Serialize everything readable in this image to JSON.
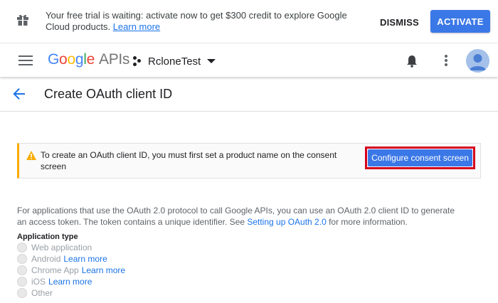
{
  "trial_banner": {
    "message": "Your free trial is waiting: activate now to get $300 credit to explore Google Cloud products.",
    "learn_more": "Learn more",
    "dismiss_label": "DISMISS",
    "activate_label": "ACTIVATE",
    "icon": "gift-icon"
  },
  "app_bar": {
    "logo": {
      "G": "G",
      "o1": "o",
      "o2": "o",
      "g": "g",
      "l": "l",
      "e": "e",
      "apis": "APIs"
    },
    "project_name": "RcloneTest",
    "icons": [
      "menu-icon",
      "project-icon",
      "caret-down-icon",
      "bell-icon",
      "more-vert-icon",
      "avatar"
    ]
  },
  "page": {
    "title": "Create OAuth client ID",
    "back_icon": "arrow-back-icon"
  },
  "warning": {
    "text": "To create an OAuth client ID, you must first set a product name on the consent screen",
    "button_label": "Configure consent screen",
    "icon": "warning-icon",
    "accent_color": "#f9ab00",
    "highlight_color": "#d6001c"
  },
  "description": {
    "text_before": "For applications that use the OAuth 2.0 protocol to call Google APIs, you can use an OAuth 2.0 client ID to generate an access token. The token contains a unique identifier. See ",
    "link": "Setting up OAuth 2.0",
    "text_after": " for more information."
  },
  "application_type": {
    "label": "Application type",
    "options": [
      {
        "label": "Web application",
        "link": ""
      },
      {
        "label": "Android",
        "link": "Learn more"
      },
      {
        "label": "Chrome App",
        "link": "Learn more"
      },
      {
        "label": "iOS",
        "link": "Learn more"
      },
      {
        "label": "Other",
        "link": ""
      }
    ]
  },
  "colors": {
    "primary_button": "#3b78e7",
    "link": "#1a73e8"
  }
}
